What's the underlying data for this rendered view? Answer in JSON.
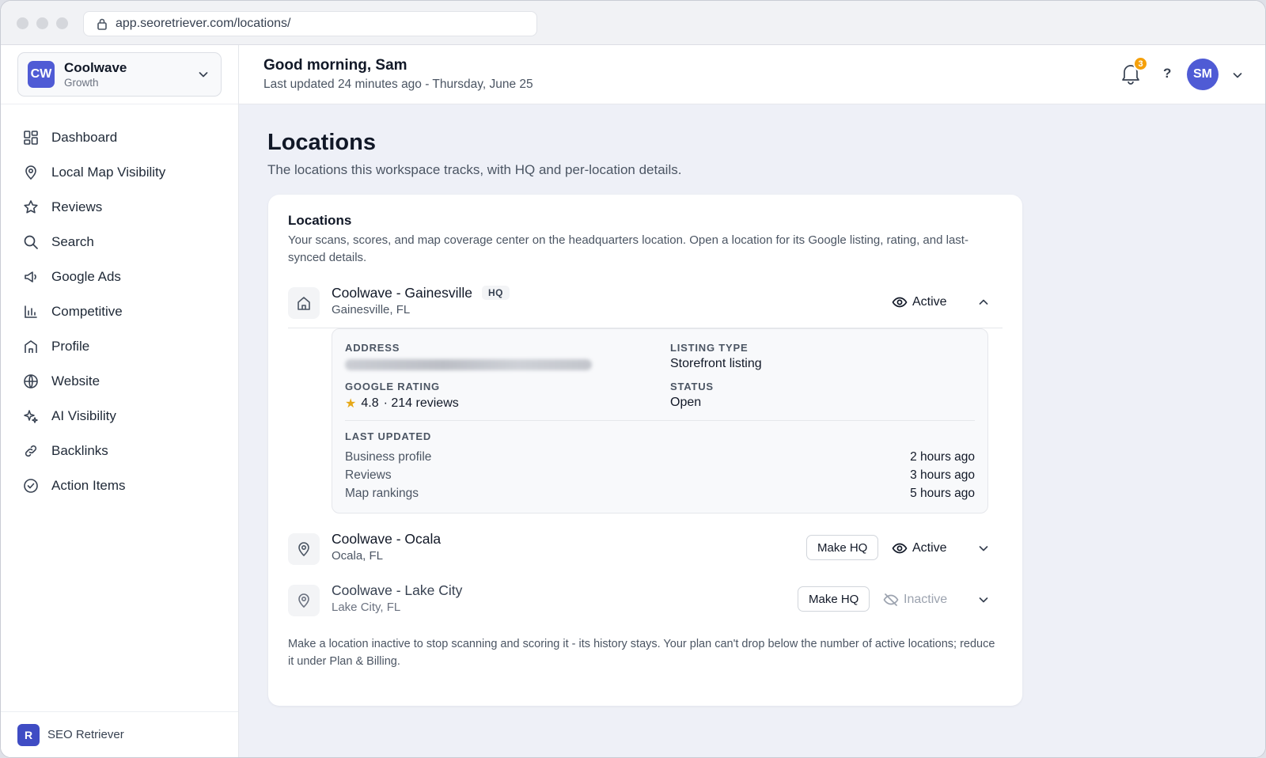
{
  "browser": {
    "url": "app.seoretriever.com/locations/"
  },
  "workspace": {
    "initials": "CW",
    "name": "Coolwave",
    "plan": "Growth"
  },
  "nav": {
    "items": [
      {
        "label": "Dashboard",
        "icon": "grid-icon"
      },
      {
        "label": "Local Map Visibility",
        "icon": "map-pin-icon"
      },
      {
        "label": "Reviews",
        "icon": "star-icon"
      },
      {
        "label": "Search",
        "icon": "search-icon"
      },
      {
        "label": "Google Ads",
        "icon": "megaphone-icon"
      },
      {
        "label": "Competitive",
        "icon": "bar-chart-icon"
      },
      {
        "label": "Profile",
        "icon": "storefront-icon"
      },
      {
        "label": "Website",
        "icon": "globe-icon"
      },
      {
        "label": "AI Visibility",
        "icon": "sparkle-icon"
      },
      {
        "label": "Backlinks",
        "icon": "link-icon"
      },
      {
        "label": "Action Items",
        "icon": "check-circle-icon"
      }
    ]
  },
  "brand": {
    "logo_letter": "R",
    "name": "SEO Retriever"
  },
  "header": {
    "greeting": "Good morning, Sam",
    "updated": "Last updated 24 minutes ago - Thursday, June 25",
    "notification_count": "3",
    "help_label": "?",
    "user_initials": "SM"
  },
  "page": {
    "title": "Locations",
    "subtitle": "The locations this workspace tracks, with HQ and per-location details."
  },
  "card": {
    "title": "Locations",
    "description": "Your scans, scores, and map coverage center on the headquarters location. Open a location for its Google listing, rating, and last-synced details.",
    "footnote": "Make a location inactive to stop scanning and scoring it - its history stays. Your plan can't drop below the number of active locations; reduce it under Plan & Billing."
  },
  "locations": [
    {
      "name": "Coolwave - Gainesville",
      "city": "Gainesville, FL",
      "hq_tag": "HQ",
      "status": "Active",
      "expanded": true
    },
    {
      "name": "Coolwave - Ocala",
      "city": "Ocala, FL",
      "button": "Make HQ",
      "status": "Active",
      "expanded": false
    },
    {
      "name": "Coolwave - Lake City",
      "city": "Lake City, FL",
      "button": "Make HQ",
      "status": "Inactive",
      "expanded": false
    }
  ],
  "details": {
    "address_label": "ADDRESS",
    "listing_type_label": "LISTING TYPE",
    "listing_type": "Storefront listing",
    "google_rating_label": "GOOGLE RATING",
    "rating": "4.8",
    "reviews": "· 214 reviews",
    "status_label": "STATUS",
    "status": "Open",
    "last_updated_label": "LAST UPDATED",
    "last_updated": [
      {
        "label": "Business profile",
        "value": "2 hours ago"
      },
      {
        "label": "Reviews",
        "value": "3 hours ago"
      },
      {
        "label": "Map rankings",
        "value": "5 hours ago"
      }
    ]
  },
  "colors": {
    "accent": "#4f5bd5",
    "badge": "#f5a00a",
    "star": "#e6a817",
    "main_bg": "#eef0f7"
  }
}
